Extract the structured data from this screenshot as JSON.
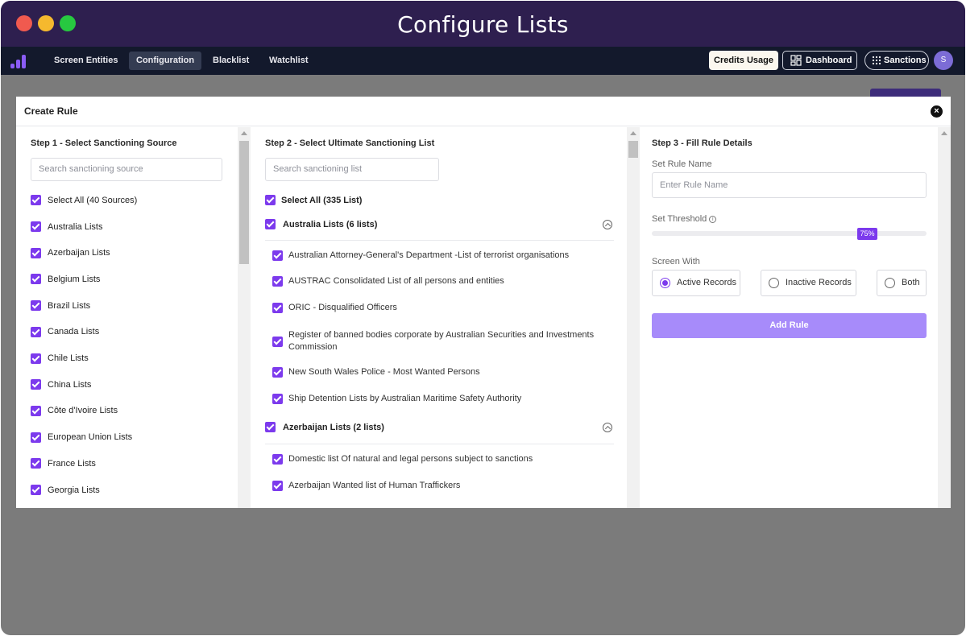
{
  "window": {
    "title": "Configure Lists"
  },
  "nav": {
    "items": [
      "Screen Entities",
      "Configuration",
      "Blacklist",
      "Watchlist"
    ],
    "active": "Configuration",
    "credits_label": "Credits Usage",
    "dashboard_label": "Dashboard",
    "sanctions_label": "Sanctions",
    "avatar_initial": "S"
  },
  "modal": {
    "title": "Create Rule",
    "step1": {
      "title": "Step 1 - Select Sanctioning Source",
      "search_placeholder": "Search sanctioning source",
      "select_all": "Select All (40 Sources)",
      "sources": [
        "Australia Lists",
        "Azerbaijan Lists",
        "Belgium Lists",
        "Brazil Lists",
        "Canada Lists",
        "Chile Lists",
        "China Lists",
        "Côte d'Ivoire Lists",
        "European Union Lists",
        "France Lists",
        "Georgia Lists"
      ]
    },
    "step2": {
      "title": "Step 2 - Select Ultimate Sanctioning List",
      "search_placeholder": "Search sanctioning list",
      "select_all": "Select All (335 List)",
      "groups": [
        {
          "label": "Australia Lists (6 lists)",
          "items": [
            "Australian Attorney-General's Department -List of terrorist organisations",
            "AUSTRAC Consolidated List of all persons and entities",
            "ORIC - Disqualified Officers",
            "Register of banned bodies corporate by Australian Securities and Investments Commission",
            "New South Wales Police - Most Wanted Persons",
            "Ship Detention Lists by Australian Maritime Safety Authority"
          ]
        },
        {
          "label": "Azerbaijan Lists (2 lists)",
          "items": [
            "Domestic list Of natural and legal persons subject to sanctions",
            "Azerbaijan Wanted list of Human Traffickers"
          ]
        }
      ]
    },
    "step3": {
      "title": "Step 3 - Fill Rule Details",
      "rule_name_label": "Set Rule Name",
      "rule_name_placeholder": "Enter Rule Name",
      "threshold_label": "Set Threshold",
      "threshold_value": "75%",
      "threshold_fraction": 0.75,
      "screen_with_label": "Screen With",
      "options": [
        "Active Records",
        "Inactive Records",
        "Both"
      ],
      "selected_option": "Active Records",
      "submit_label": "Add Rule"
    }
  },
  "colors": {
    "titlebar": "#2e1f4f",
    "navbar": "#13192c",
    "accent": "#7c3aed",
    "button": "#a78bfa",
    "overlay": "#7b7b7b"
  }
}
